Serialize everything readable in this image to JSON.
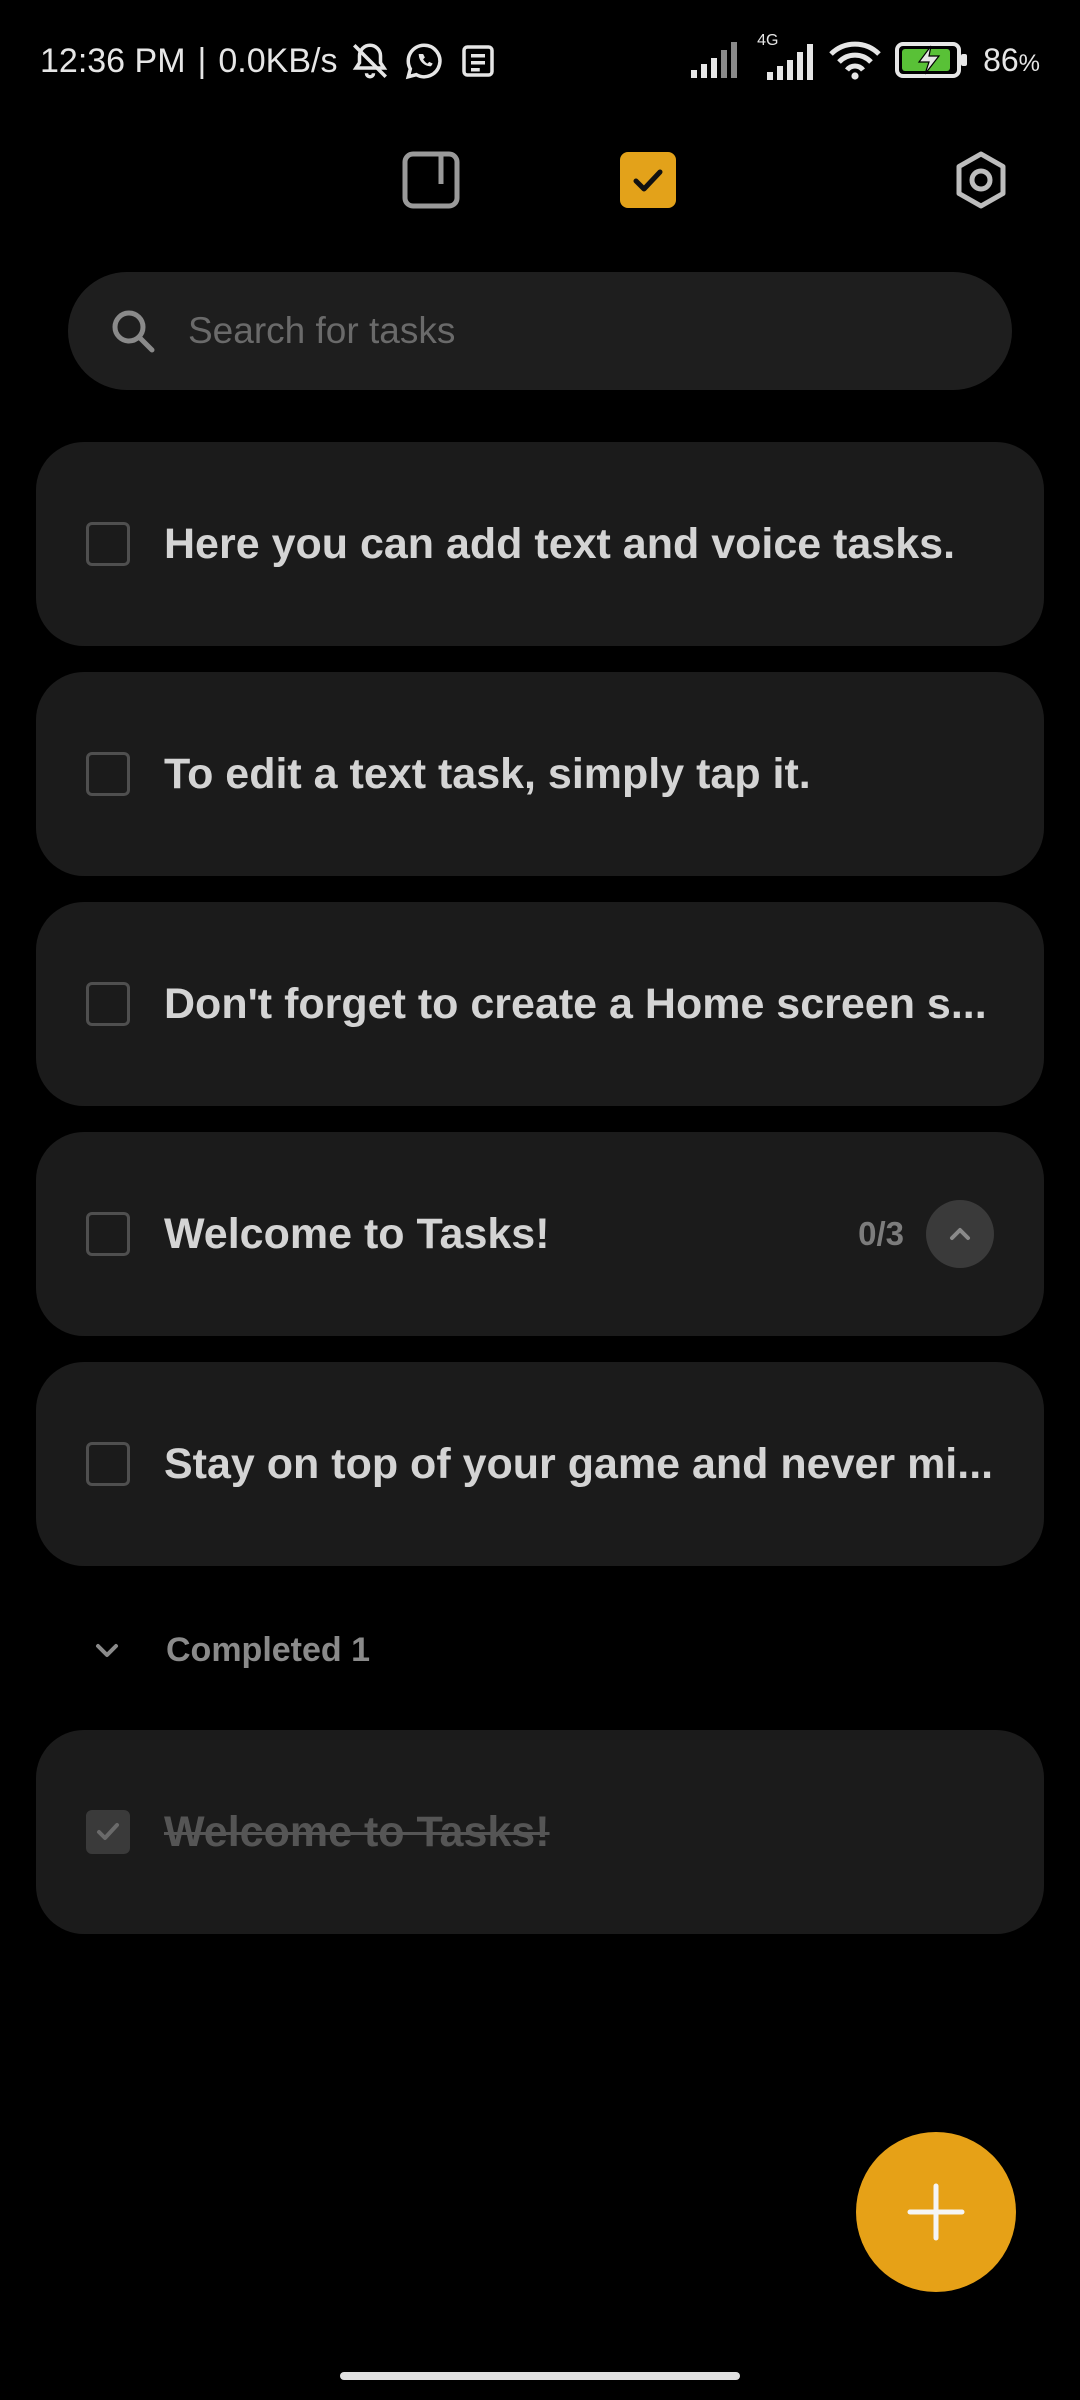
{
  "status_bar": {
    "time": "12:36 PM",
    "separator": "|",
    "net_speed": "0.0KB/s",
    "battery_level": "86",
    "battery_unit": "%",
    "network_type": "4G",
    "icons": [
      "bell-off-icon",
      "whatsapp-icon",
      "news-icon",
      "signal-icon",
      "signal-4g-icon",
      "wifi-icon",
      "battery-charging-icon"
    ]
  },
  "toolbar": {
    "icons": [
      "notes-icon",
      "tasks-icon",
      "settings-icon"
    ],
    "active_tab": "tasks",
    "accent_color": "#e3a21a"
  },
  "search": {
    "placeholder": "Search for tasks",
    "value": ""
  },
  "tasks": [
    {
      "text": "Here you can add text and voice tasks.",
      "checked": false
    },
    {
      "text": "To edit a text task, simply tap it.",
      "checked": false
    },
    {
      "text": "Don't forget to create a Home screen s...",
      "checked": false
    },
    {
      "text": "Welcome to Tasks!",
      "checked": false,
      "subtasks": "0/3",
      "expand_icon": "chevron-up-icon"
    },
    {
      "text": "Stay on top of your game and never mi...",
      "checked": false
    }
  ],
  "completed": {
    "label": "Completed 1",
    "icon": "chevron-down-icon",
    "items": [
      {
        "text": "Welcome to Tasks!",
        "checked": true
      }
    ]
  },
  "fab": {
    "icon": "plus-icon",
    "color": "#e6a117"
  }
}
